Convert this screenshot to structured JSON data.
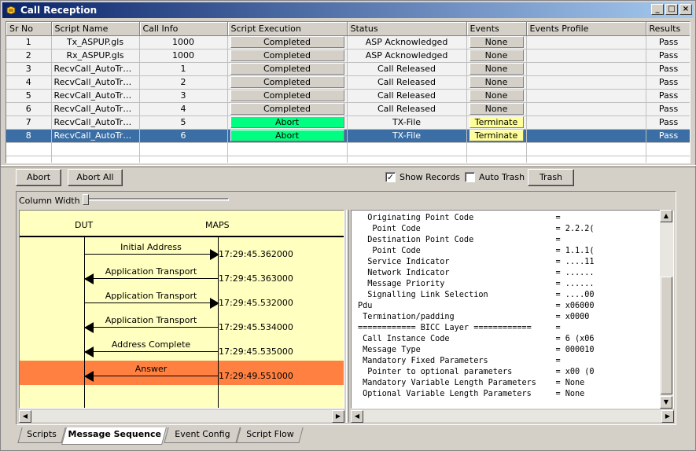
{
  "window": {
    "title": "Call Reception"
  },
  "grid": {
    "columns": [
      "Sr No",
      "Script Name",
      "Call Info",
      "Script Execution",
      "Status",
      "Events",
      "Events Profile",
      "Results"
    ],
    "rows": [
      {
        "sr": "1",
        "name": "Tx_ASPUP.gls",
        "info": "1000",
        "exec": "Completed",
        "status": "ASP Acknowledged",
        "events": "None",
        "profile": "",
        "result": "Pass"
      },
      {
        "sr": "2",
        "name": "Rx_ASPUP.gls",
        "info": "1000",
        "exec": "Completed",
        "status": "ASP Acknowledged",
        "events": "None",
        "profile": "",
        "result": "Pass"
      },
      {
        "sr": "3",
        "name": "RecvCall_AutoTraffic...",
        "info": "1",
        "exec": "Completed",
        "status": "Call Released",
        "events": "None",
        "profile": "",
        "result": "Pass"
      },
      {
        "sr": "4",
        "name": "RecvCall_AutoTraffic...",
        "info": "2",
        "exec": "Completed",
        "status": "Call Released",
        "events": "None",
        "profile": "",
        "result": "Pass"
      },
      {
        "sr": "5",
        "name": "RecvCall_AutoTraffic...",
        "info": "3",
        "exec": "Completed",
        "status": "Call Released",
        "events": "None",
        "profile": "",
        "result": "Pass"
      },
      {
        "sr": "6",
        "name": "RecvCall_AutoTraffic...",
        "info": "4",
        "exec": "Completed",
        "status": "Call Released",
        "events": "None",
        "profile": "",
        "result": "Pass"
      },
      {
        "sr": "7",
        "name": "RecvCall_AutoTraffic...",
        "info": "5",
        "exec": "Abort",
        "status": "TX-File",
        "events": "Terminate",
        "profile": "",
        "result": "Pass"
      },
      {
        "sr": "8",
        "name": "RecvCall_AutoTraffic...",
        "info": "6",
        "exec": "Abort",
        "status": "TX-File",
        "events": "Terminate",
        "profile": "",
        "result": "Pass"
      }
    ],
    "selected_row": "8"
  },
  "toolbar": {
    "abort_label": "Abort",
    "abort_all_label": "Abort All",
    "show_records_label": "Show Records",
    "show_records_checked": true,
    "auto_trash_label": "Auto Trash",
    "auto_trash_checked": false,
    "trash_label": "Trash"
  },
  "sequence": {
    "column_width_label": "Column Width",
    "left_entity": "DUT",
    "right_entity": "MAPS",
    "messages": [
      {
        "label": "Initial Address",
        "time": "17:29:45.362000",
        "dir": "right",
        "highlight": false
      },
      {
        "label": "Application Transport",
        "time": "17:29:45.363000",
        "dir": "left",
        "highlight": false
      },
      {
        "label": "Application Transport",
        "time": "17:29:45.532000",
        "dir": "right",
        "highlight": false
      },
      {
        "label": "Application Transport",
        "time": "17:29:45.534000",
        "dir": "left",
        "highlight": false
      },
      {
        "label": "Address Complete",
        "time": "17:29:45.535000",
        "dir": "left",
        "highlight": false
      },
      {
        "label": "Answer",
        "time": "17:29:49.551000",
        "dir": "left",
        "highlight": true
      }
    ],
    "highlight_color": "#ff8040"
  },
  "detail": {
    "lines": [
      "  Originating Point Code                 =",
      "   Point Code                            = 2.2.2(",
      "  Destination Point Code                 =",
      "   Point Code                            = 1.1.1(",
      "  Service Indicator                      = ....11",
      "  Network Indicator                      = ......",
      "  Message Priority                       = ......",
      "  Signalling Link Selection              = ....00",
      "Pdu                                      = x06000",
      " Termination/padding                     = x0000 ",
      "============ BICC Layer ============     =",
      " Call Instance Code                      = 6 (x06",
      " Message Type                            = 000010",
      " Mandatory Fixed Parameters              =",
      "  Pointer to optional parameters         = x00 (0",
      " Mandatory Variable Length Parameters    = None",
      " Optional Variable Length Parameters     = None"
    ]
  },
  "tabs": [
    {
      "label": "Scripts",
      "active": false
    },
    {
      "label": "Message Sequence",
      "active": true
    },
    {
      "label": "Event Config",
      "active": false
    },
    {
      "label": "Script Flow",
      "active": false
    }
  ],
  "colors": {
    "abort": "#00ff80",
    "terminate": "#ffff99",
    "selection": "#3a6ea5",
    "sequence_bg": "#ffffc0"
  },
  "icons": [
    "app-icon",
    "minimize-icon",
    "maximize-icon",
    "close-icon",
    "scroll-left-icon",
    "scroll-right-icon",
    "scroll-up-icon",
    "scroll-down-icon"
  ]
}
